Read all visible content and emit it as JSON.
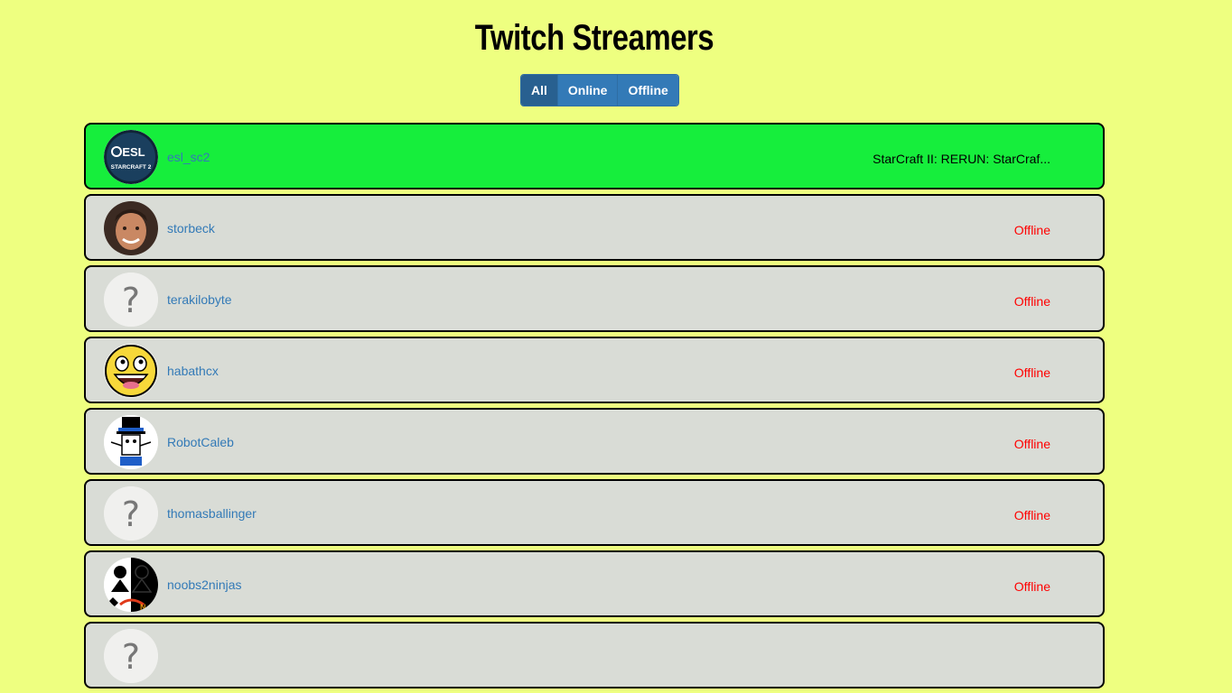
{
  "page": {
    "title": "Twitch Streamers"
  },
  "filters": [
    "All",
    "Online",
    "Offline"
  ],
  "streamers": [
    {
      "name": "esl_sc2",
      "status": "StarCraft II: RERUN: StarCraf...",
      "online": true,
      "avatar": "esl-starcraft2-logo"
    },
    {
      "name": "storbeck",
      "status": "Offline",
      "online": false,
      "avatar": "user-photo"
    },
    {
      "name": "terakilobyte",
      "status": "Offline",
      "online": false,
      "avatar": "question-mark-icon"
    },
    {
      "name": "habathcx",
      "status": "Offline",
      "online": false,
      "avatar": "smiley-face-icon"
    },
    {
      "name": "RobotCaleb",
      "status": "Offline",
      "online": false,
      "avatar": "robot-tophat-icon"
    },
    {
      "name": "thomasballinger",
      "status": "Offline",
      "online": false,
      "avatar": "question-mark-icon"
    },
    {
      "name": "noobs2ninjas",
      "status": "Offline",
      "online": false,
      "avatar": "noobs2ninjas-logo"
    },
    {
      "name": "",
      "status": "",
      "online": false,
      "avatar": "question-mark-icon"
    }
  ],
  "colors": {
    "background": "#eeff80",
    "online_row": "#16ee3c",
    "offline_row": "#d9dcd6",
    "button": "#337ab7",
    "link": "#337ab7",
    "offline_text": "#ff0000"
  }
}
